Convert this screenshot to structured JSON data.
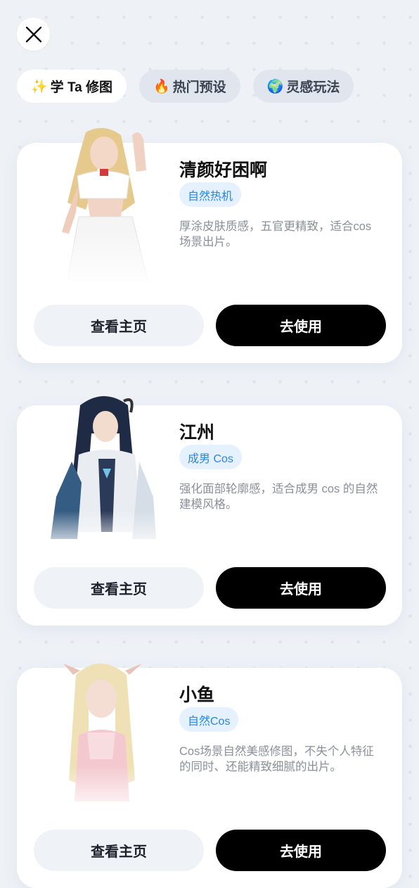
{
  "tabs": [
    {
      "emoji": "✨",
      "label": "学 Ta 修图",
      "active": true
    },
    {
      "emoji": "🔥",
      "label": "热门预设",
      "active": false
    },
    {
      "emoji": "🌍",
      "label": "灵感玩法",
      "active": false
    }
  ],
  "cards": [
    {
      "title": "清颜好困啊",
      "tag": "自然热机",
      "description": "厚涂皮肤质感，五官更精致，适合cos 场景出片。",
      "secondary_label": "查看主页",
      "primary_label": "去使用"
    },
    {
      "title": "江州",
      "tag": "成男 Cos",
      "description": "强化面部轮廓感，适合成男 cos 的自然建模风格。",
      "secondary_label": "查看主页",
      "primary_label": "去使用"
    },
    {
      "title": "小鱼",
      "tag": "自然Cos",
      "description": "Cos场景自然美感修图，不失个人特征的同时、还能精致细腻的出片。",
      "secondary_label": "查看主页",
      "primary_label": "去使用"
    }
  ],
  "colors": {
    "background": "#eef2f7",
    "tag_bg": "#e5f1ff",
    "tag_text": "#2a86de",
    "primary_button": "#000000"
  }
}
